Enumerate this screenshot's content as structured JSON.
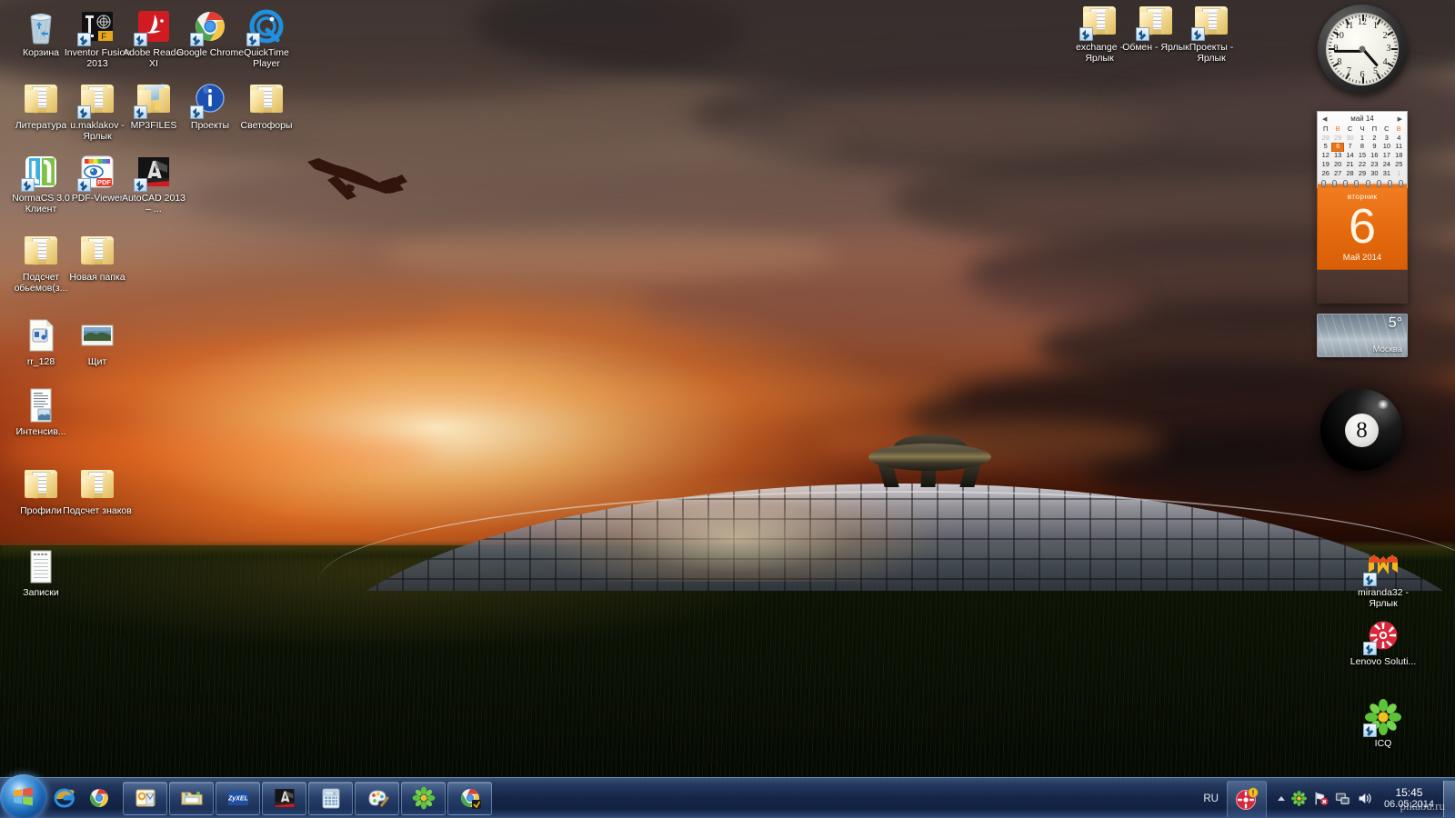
{
  "desktop": {
    "wallpaper_description": "Sunset over a field with a futuristic glass dome bridge and UFO-shaped structure; airliner silhouette in the sky",
    "accent_orange": "#ea7418",
    "taskbar_blue": "#16284c",
    "icons_left": [
      {
        "label": "Корзина",
        "type": "recycle-bin",
        "shortcut": false
      },
      {
        "label": "Inventor Fusion 2013",
        "type": "app-inventor",
        "shortcut": true
      },
      {
        "label": "Adobe Reader XI",
        "type": "app-adobe-reader",
        "shortcut": true
      },
      {
        "label": "Google Chrome",
        "type": "app-chrome",
        "shortcut": true
      },
      {
        "label": "QuickTime Player",
        "type": "app-quicktime",
        "shortcut": true
      },
      {
        "label": "Литература",
        "type": "folder",
        "shortcut": false
      },
      {
        "label": "u.maklakov - Ярлык",
        "type": "folder",
        "shortcut": true
      },
      {
        "label": "MP3FILES",
        "type": "folder-media",
        "shortcut": true
      },
      {
        "label": "Проекты",
        "type": "app-info",
        "shortcut": true
      },
      {
        "label": "Светофоры",
        "type": "folder",
        "shortcut": false
      },
      {
        "label": "NormaCS 3.0 Клиент",
        "type": "app-normacs",
        "shortcut": true
      },
      {
        "label": "PDF-Viewer",
        "type": "app-pdf-viewer",
        "shortcut": true
      },
      {
        "label": "AutoCAD 2013 – ...",
        "type": "app-autocad",
        "shortcut": true
      },
      {
        "label": "Подсчет обьемов(з...",
        "type": "folder",
        "shortcut": false
      },
      {
        "label": "Новая папка",
        "type": "folder",
        "shortcut": false
      },
      {
        "label": "rr_128",
        "type": "file-audio",
        "shortcut": false
      },
      {
        "label": "Щит",
        "type": "file-image",
        "shortcut": false
      },
      {
        "label": "Интенсив...",
        "type": "file-document",
        "shortcut": false
      },
      {
        "label": "Профили",
        "type": "folder",
        "shortcut": false
      },
      {
        "label": "Подсчет знаков",
        "type": "folder",
        "shortcut": false
      },
      {
        "label": "Записки",
        "type": "file-text",
        "shortcut": false
      }
    ],
    "icons_top_right": [
      {
        "label": "exchange - Ярлык",
        "type": "folder",
        "shortcut": true
      },
      {
        "label": "Обмен - Ярлык",
        "type": "folder",
        "shortcut": true
      },
      {
        "label": "Проекты - Ярлык",
        "type": "folder",
        "shortcut": true
      }
    ],
    "icons_bottom_right": [
      {
        "label": "miranda32 - Ярлык",
        "type": "app-miranda",
        "shortcut": true
      },
      {
        "label": "Lenovo Soluti...",
        "type": "app-lenovo",
        "shortcut": true
      },
      {
        "label": "ICQ",
        "type": "app-icq",
        "shortcut": true
      }
    ]
  },
  "gadgets": {
    "clock": {
      "name": "analog-clock",
      "hour_numerals": [
        "12",
        "1",
        "2",
        "3",
        "4",
        "5",
        "6",
        "7",
        "8",
        "9",
        "10",
        "11"
      ],
      "displayed_time": "15:45"
    },
    "calendar": {
      "month_title": "май 14",
      "prev_label": "◀",
      "next_label": "▶",
      "weekdays": [
        "П",
        "В",
        "С",
        "Ч",
        "П",
        "С",
        "В"
      ],
      "weeks": [
        [
          {
            "d": "28",
            "out": true
          },
          {
            "d": "29",
            "out": true
          },
          {
            "d": "30",
            "out": true
          },
          {
            "d": "1"
          },
          {
            "d": "2"
          },
          {
            "d": "3"
          },
          {
            "d": "4"
          }
        ],
        [
          {
            "d": "5"
          },
          {
            "d": "6",
            "today": true
          },
          {
            "d": "7"
          },
          {
            "d": "8"
          },
          {
            "d": "9"
          },
          {
            "d": "10"
          },
          {
            "d": "11"
          }
        ],
        [
          {
            "d": "12"
          },
          {
            "d": "13"
          },
          {
            "d": "14"
          },
          {
            "d": "15"
          },
          {
            "d": "16"
          },
          {
            "d": "17"
          },
          {
            "d": "18"
          }
        ],
        [
          {
            "d": "19"
          },
          {
            "d": "20"
          },
          {
            "d": "21"
          },
          {
            "d": "22"
          },
          {
            "d": "23"
          },
          {
            "d": "24"
          },
          {
            "d": "25"
          }
        ],
        [
          {
            "d": "26"
          },
          {
            "d": "27"
          },
          {
            "d": "28"
          },
          {
            "d": "29"
          },
          {
            "d": "30"
          },
          {
            "d": "31"
          },
          {
            "d": "1",
            "out": true
          }
        ]
      ],
      "day_of_week": "вторник",
      "day_number": "6",
      "month_year": "Май 2014"
    },
    "weather": {
      "temperature": "5°",
      "city": "Москва",
      "condition": "rain"
    },
    "magic8ball": {
      "number": "8"
    }
  },
  "taskbar": {
    "start_tooltip": "Пуск",
    "quick_launch": [
      {
        "name": "internet-explorer",
        "title": "Internet Explorer"
      },
      {
        "name": "google-chrome",
        "title": "Google Chrome"
      }
    ],
    "running": [
      {
        "name": "microsoft-outlook",
        "title": "Microsoft Outlook"
      },
      {
        "name": "windows-explorer",
        "title": "Проводник"
      },
      {
        "name": "zyxel",
        "title": "ZyXEL"
      },
      {
        "name": "autocad",
        "title": "AutoCAD"
      },
      {
        "name": "calculator",
        "title": "Калькулятор"
      },
      {
        "name": "paint",
        "title": "Paint"
      },
      {
        "name": "icq",
        "title": "ICQ"
      },
      {
        "name": "google-chrome-window",
        "title": "Google Chrome"
      }
    ],
    "tray": {
      "language": "RU",
      "chevron_label": "▲",
      "pinned_icon": "normacs-notify",
      "icons": [
        {
          "name": "icq-tray-icon"
        },
        {
          "name": "network-error-icon"
        },
        {
          "name": "network-monitor-icon"
        },
        {
          "name": "volume-icon"
        }
      ],
      "clock_time": "15:45",
      "clock_date": "06.05.2014",
      "watermark": "pikabu.ru"
    }
  }
}
